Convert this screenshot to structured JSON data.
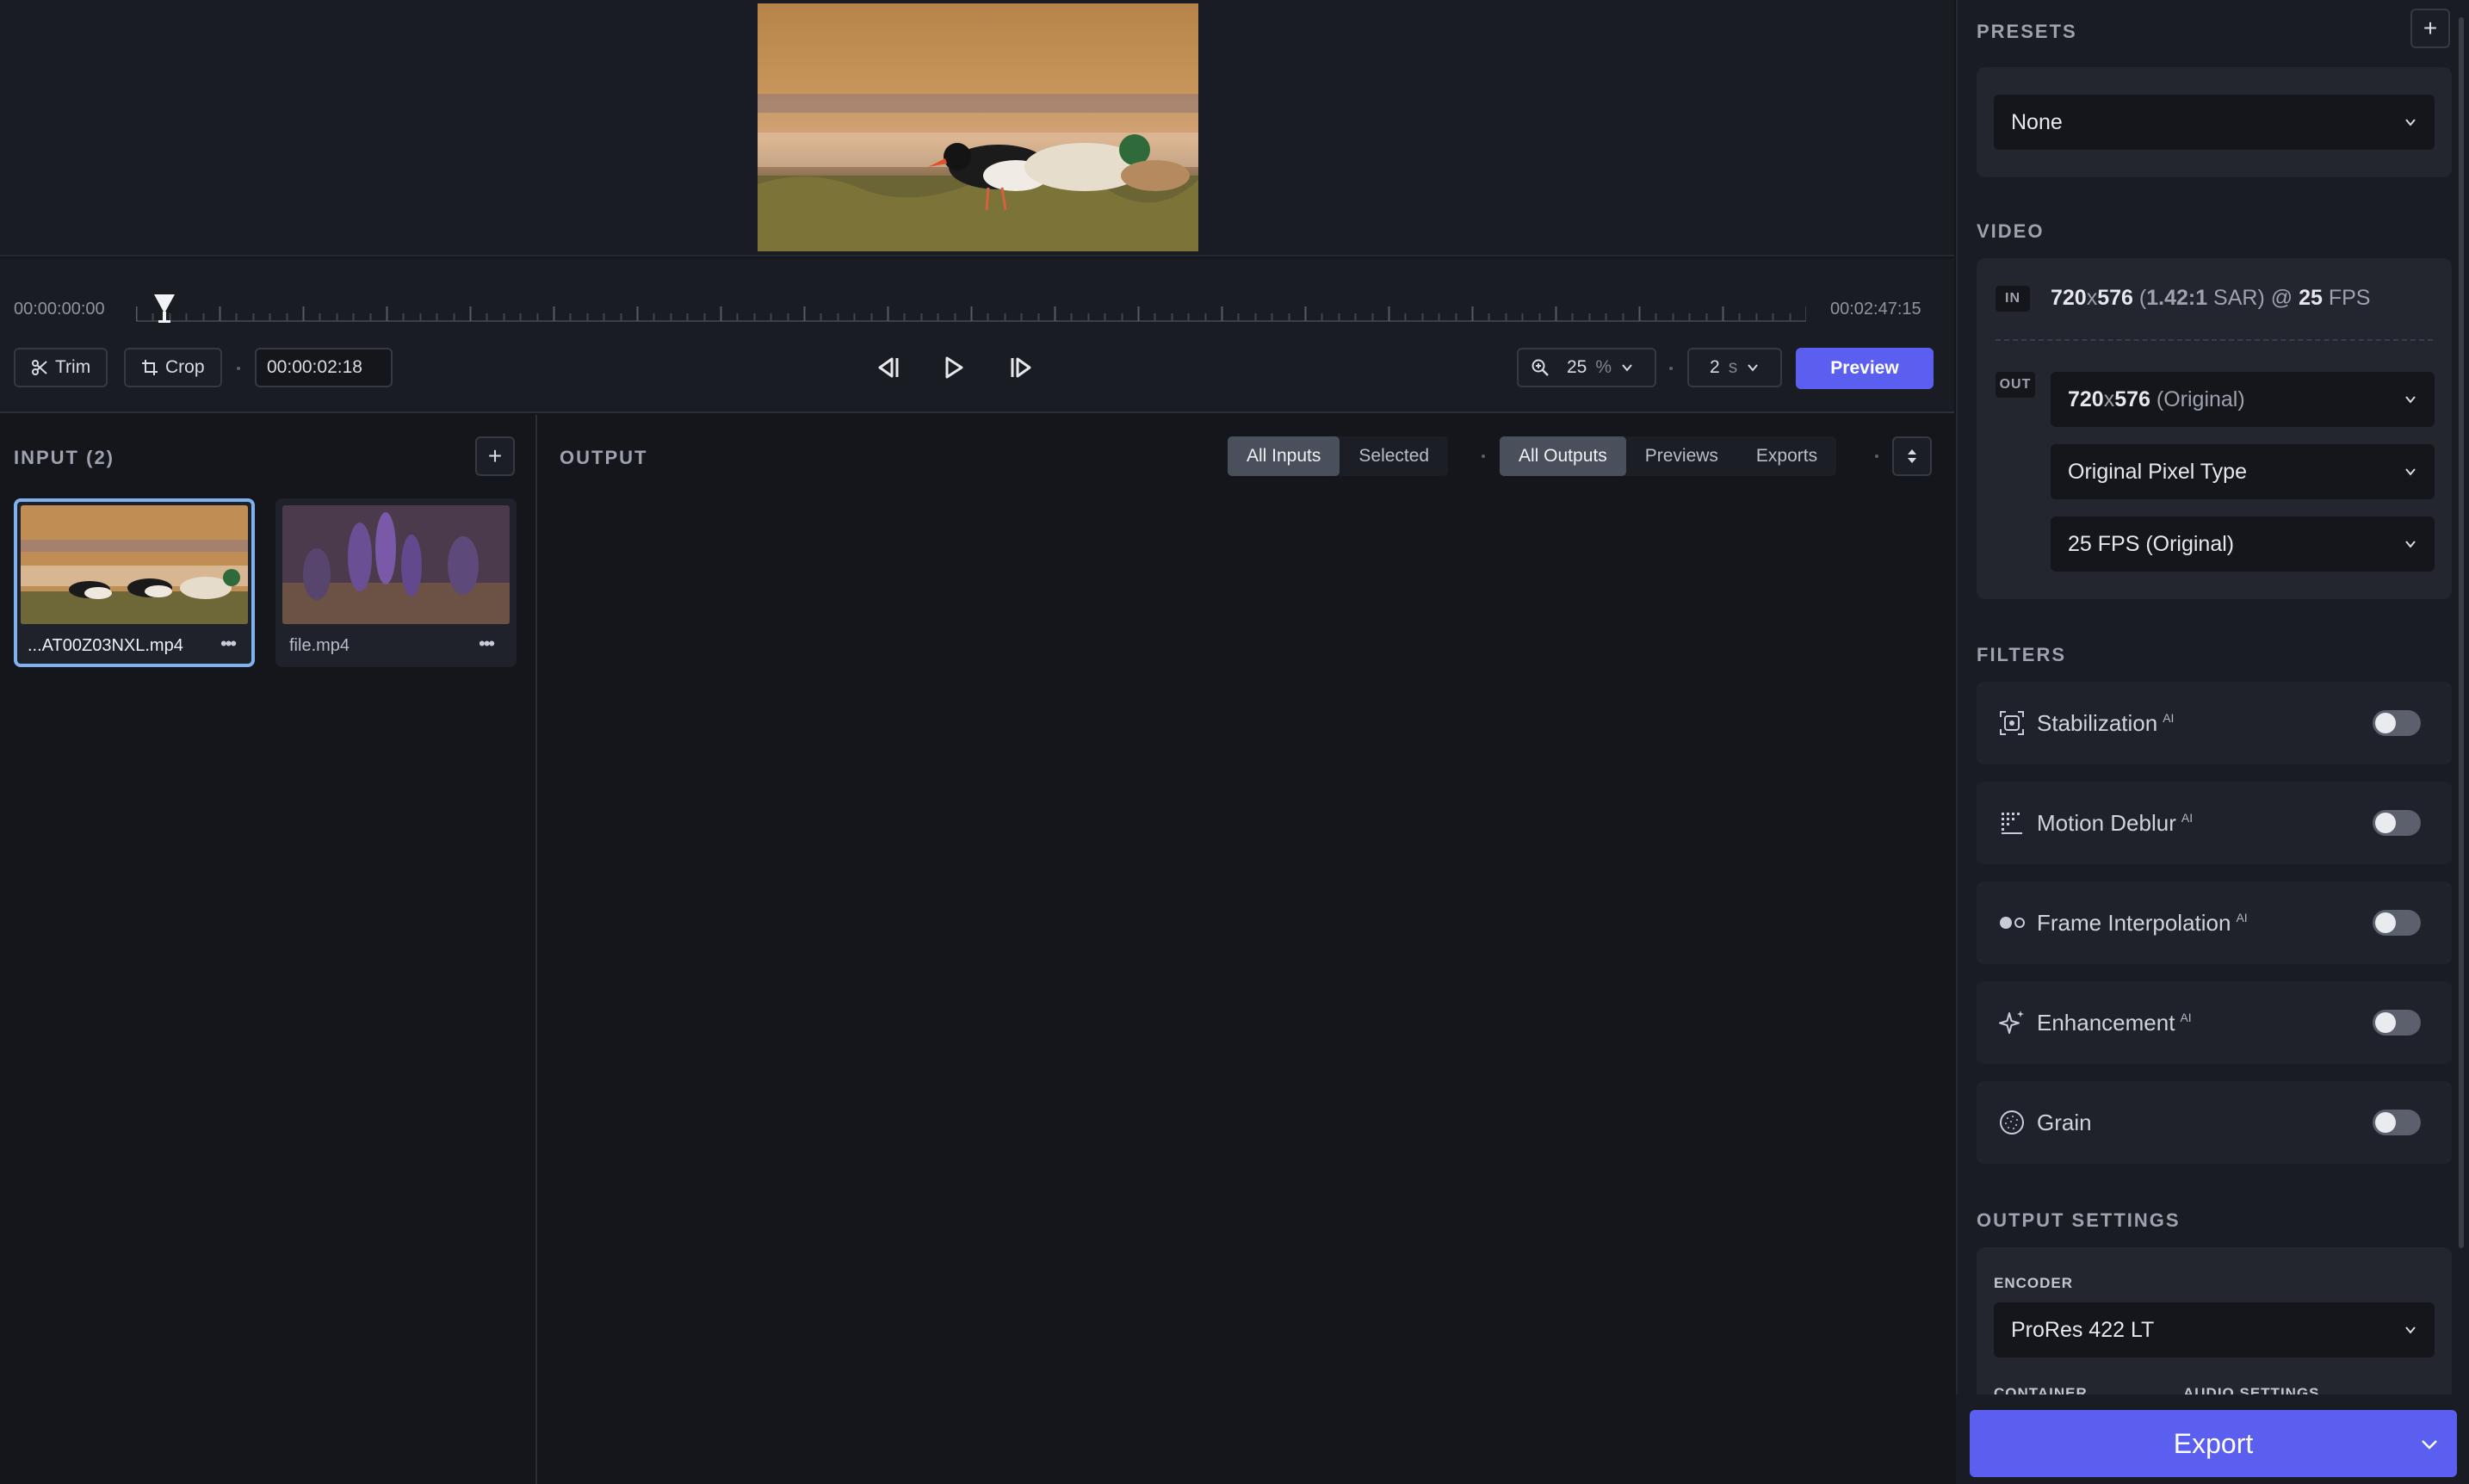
{
  "timeline": {
    "start_time": "00:00:00:00",
    "end_time": "00:02:47:15",
    "playhead_fraction": 0.0095
  },
  "toolbar": {
    "trim_label": "Trim",
    "crop_label": "Crop",
    "current_time": "00:00:02:18",
    "zoom_value": "25",
    "zoom_unit": "%",
    "step_value": "2",
    "step_unit": "s",
    "preview_label": "Preview"
  },
  "input": {
    "title": "INPUT (2)",
    "add_label": "+",
    "files": [
      {
        "name": "...AT00Z03NXL.mp4",
        "more": "•••"
      },
      {
        "name": "file.mp4",
        "more": "•••"
      }
    ]
  },
  "output": {
    "title": "OUTPUT",
    "input_filters": [
      "All Inputs",
      "Selected"
    ],
    "output_filters": [
      "All Outputs",
      "Previews",
      "Exports"
    ]
  },
  "sidebar": {
    "presets_title": "PRESETS",
    "presets_add": "+",
    "preset_value": "None",
    "video_title": "VIDEO",
    "in_tag": "IN",
    "in_res": "720",
    "in_x": "x",
    "in_res2": "576",
    "in_sar_open": " (",
    "in_sar_val": "1.42:1",
    "in_sar_close": " SAR) @ ",
    "in_fps": "25",
    "in_fps_unit": " FPS",
    "out_tag": "OUT",
    "out_res": "720",
    "out_x": "x",
    "out_res2": "576",
    "out_res_note": " (Original)",
    "pixel_type": "Original Pixel Type",
    "fps": "25 FPS (Original)",
    "filters_title": "FILTERS",
    "filters": [
      {
        "label": "Stabilization",
        "badge": "AI",
        "enabled": false
      },
      {
        "label": "Motion Deblur",
        "badge": "AI",
        "enabled": false
      },
      {
        "label": "Frame Interpolation",
        "badge": "AI",
        "enabled": false
      },
      {
        "label": "Enhancement",
        "badge": "AI",
        "enabled": false
      },
      {
        "label": "Grain",
        "badge": "",
        "enabled": false
      }
    ],
    "output_settings_title": "OUTPUT SETTINGS",
    "encoder_label": "ENCODER",
    "encoder_value": "ProRes 422 LT",
    "container_label": "CONTAINER",
    "audio_label": "AUDIO SETTINGS",
    "export_label": "Export"
  },
  "colors": {
    "accent": "#5b5ff0",
    "selected_border": "#7fb2ee",
    "background": "#14161c",
    "panel": "#191c23"
  }
}
